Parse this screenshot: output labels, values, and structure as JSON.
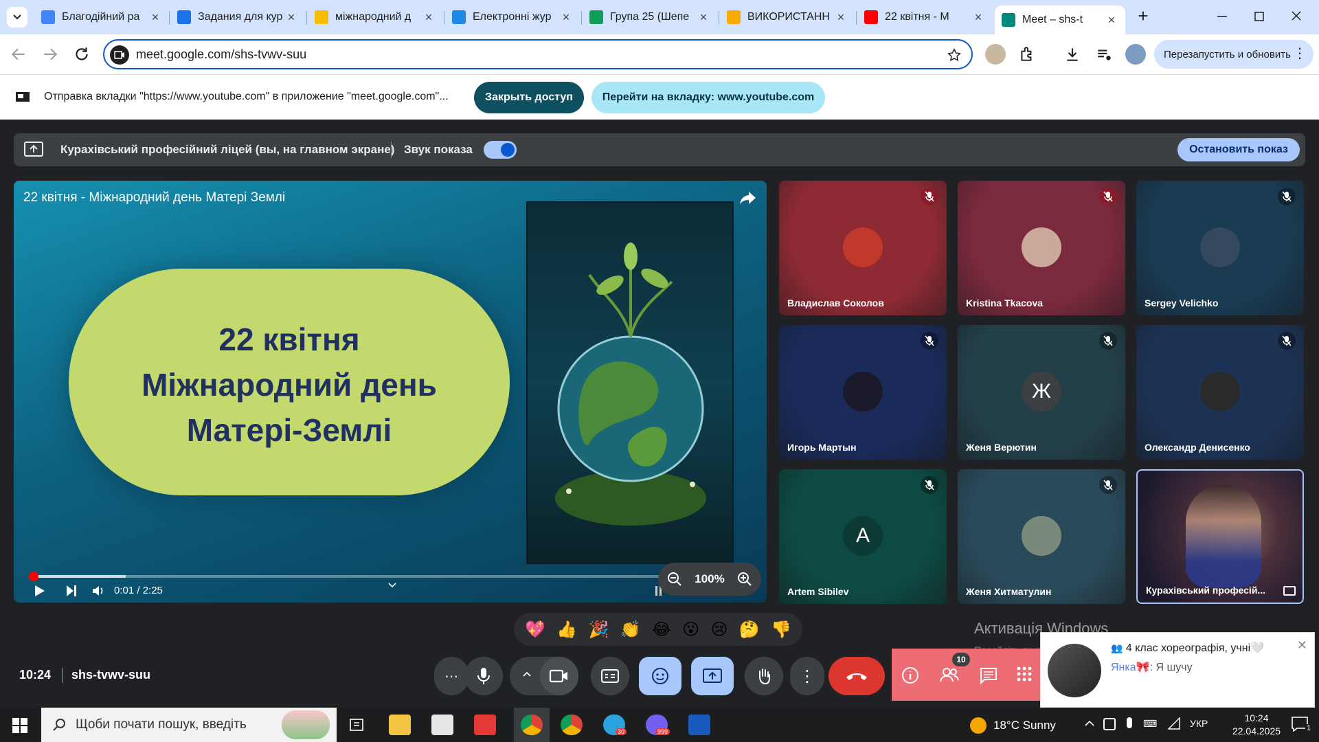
{
  "browser": {
    "tabs": [
      {
        "title": "Благодійний ра",
        "favicon_color": "#4285f4"
      },
      {
        "title": "Задания для кур",
        "favicon_color": "#1a73e8"
      },
      {
        "title": "міжнародний д",
        "favicon_color": "#fbbc04"
      },
      {
        "title": "Електронні жур",
        "favicon_color": "#1e88e5"
      },
      {
        "title": "Група 25 (Шепе",
        "favicon_color": "#0f9d58"
      },
      {
        "title": "ВИКОРИСТАНН",
        "favicon_color": "#f9ab00"
      },
      {
        "title": "22 квітня - М",
        "favicon_color": "#ff0000"
      },
      {
        "title": "Meet – shs-t",
        "favicon_color": "#00897b"
      }
    ],
    "url": "meet.google.com/shs-tvwv-suu",
    "relaunch_label": "Перезапустить и обновить"
  },
  "infobar": {
    "text": "Отправка вкладки \"https://www.youtube.com\" в приложение \"meet.google.com\"...",
    "close_access_label": "Закрыть доступ",
    "goto_tab_label": "Перейти на вкладку: www.youtube.com"
  },
  "presentation_bar": {
    "presenter_text": "Курахівський професійний ліцей (вы, на главном экране)",
    "sound_label": "Звук показа",
    "stop_label": "Остановить показ"
  },
  "video": {
    "title": "22 квітня - Міжнародний день Матері Землі",
    "slide_line1": "22 квітня",
    "slide_line2": "Міжнародний день",
    "slide_line3": "Матері-Землі",
    "time": "0:01 / 2:25",
    "progress": 0.01,
    "zoom": "100%"
  },
  "participants": [
    {
      "name": "Владислав Соколов",
      "bg": "#8e2a33",
      "avatar_bg": "#c0392b",
      "initial": "",
      "mic_red": true
    },
    {
      "name": "Kristina Tkacova",
      "bg": "#7a2a3c",
      "avatar_bg": "#caa99a",
      "initial": "",
      "mic_red": true
    },
    {
      "name": "Sergey Velichko",
      "bg": "#1a3b52",
      "avatar_bg": "#34495e",
      "initial": "",
      "mic_red": false
    },
    {
      "name": "Игорь Мартын",
      "bg": "#1a2b5a",
      "avatar_bg": "#1a1a2a",
      "initial": "",
      "mic_red": false
    },
    {
      "name": "Женя Верютин",
      "bg": "#23404a",
      "avatar_bg": "#3c4043",
      "initial": "Ж",
      "mic_red": false
    },
    {
      "name": "Олександр Денисенко",
      "bg": "#1d3355",
      "avatar_bg": "#2a2a2a",
      "initial": "",
      "mic_red": false
    },
    {
      "name": "Artem Sibilev",
      "bg": "#0d4a42",
      "avatar_bg": "#0c3b35",
      "initial": "A",
      "mic_red": false
    },
    {
      "name": "Женя Хитматулин",
      "bg": "#2a4a5a",
      "avatar_bg": "#7a8a7a",
      "initial": "",
      "mic_red": false
    },
    {
      "name": "Курахівський професій...",
      "bg": "#2a1f35",
      "avatar_bg": "#6a4a3a",
      "initial": "",
      "mic_red": false
    }
  ],
  "reactions": [
    "💖",
    "👍",
    "🎉",
    "👏",
    "😂",
    "😮",
    "😢",
    "🤔",
    "👎"
  ],
  "footer": {
    "time": "10:24",
    "meeting_code": "shs-tvwv-suu",
    "participant_count": "10"
  },
  "activation": {
    "title": "Активація Windows",
    "subtitle": "Перейдіть до розділу \"Настройки\", щоб активувати Windows."
  },
  "chat_popup": {
    "title": "4 клас хореографія, учні🤍",
    "sender": "Янка🎀",
    "message": ": Я шучу"
  },
  "taskbar": {
    "search_placeholder": "Щоби почати пошук, введіть",
    "weather": "18°C  Sunny",
    "lang": "УКР",
    "time": "10:24",
    "date": "22.04.2025",
    "telegram_badge": "30",
    "viber_badge": "999",
    "notif_count": "1"
  }
}
